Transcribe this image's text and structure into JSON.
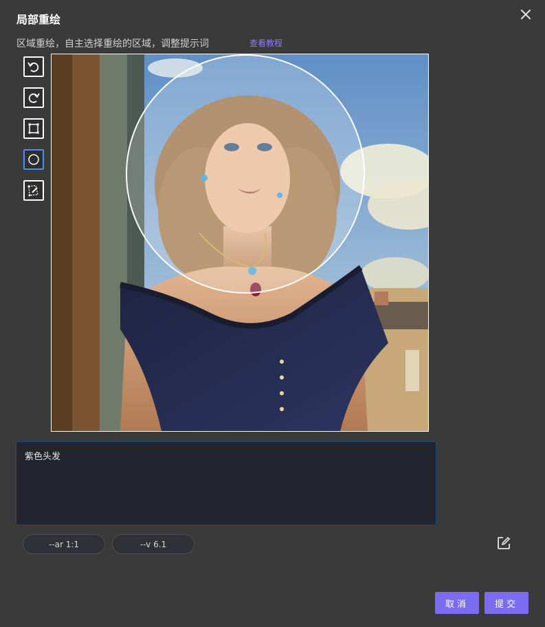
{
  "dialog": {
    "title": "局部重绘",
    "subtitle": "区域重绘，自主选择重绘的区域，调整提示词",
    "tutorial_link": "查看教程"
  },
  "tools": [
    {
      "name": "undo-icon",
      "active": false
    },
    {
      "name": "redo-icon",
      "active": false
    },
    {
      "name": "rectangle-select-icon",
      "active": false
    },
    {
      "name": "circle-select-icon",
      "active": true
    },
    {
      "name": "lasso-select-icon",
      "active": false
    }
  ],
  "prompt": {
    "value": "紫色头发"
  },
  "params": [
    {
      "label": "--ar 1:1"
    },
    {
      "label": "--v 6.1"
    }
  ],
  "buttons": {
    "cancel": "取消",
    "submit": "提交"
  },
  "colors": {
    "accent": "#7b6cf0",
    "active_tool_border": "#4d8ff7",
    "background": "#3a3a3a"
  }
}
